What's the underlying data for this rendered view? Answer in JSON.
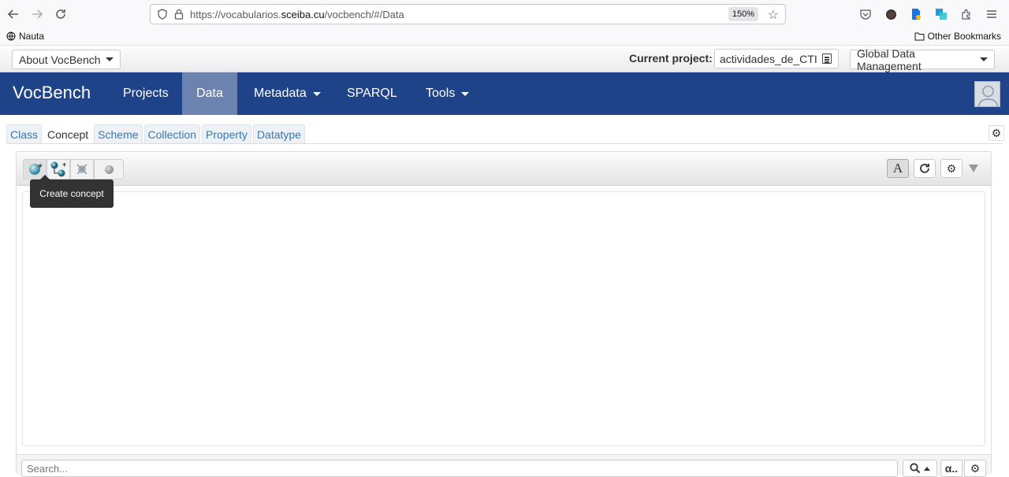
{
  "browser": {
    "url_prefix": "https://vocabularios.",
    "url_domain": "sceiba.cu",
    "url_suffix": "/vocbench/#/Data",
    "zoom": "150%",
    "bookmark_left": "Nauta",
    "bookmark_right": "Other Bookmarks"
  },
  "topbar": {
    "about_label": "About VocBench",
    "current_project_label": "Current project:",
    "current_project_value": "actividades_de_CTI",
    "global_data_label": "Global Data Management"
  },
  "navbar": {
    "brand": "VocBench",
    "items": [
      {
        "label": "Projects"
      },
      {
        "label": "Data"
      },
      {
        "label": "Metadata"
      },
      {
        "label": "SPARQL"
      },
      {
        "label": "Tools"
      }
    ]
  },
  "tabs": [
    "Class",
    "Concept",
    "Scheme",
    "Collection",
    "Property",
    "Datatype"
  ],
  "active_tab": "Concept",
  "panel": {
    "tooltip": "Create concept",
    "lang_button": "A",
    "search_placeholder": "Search...",
    "alpha_label": "α.."
  },
  "icons": {
    "back": "arrow-left-icon",
    "forward": "arrow-right-icon",
    "reload": "reload-icon",
    "settings": "gear-icon"
  },
  "colors": {
    "navbar": "#1e4388",
    "navbar_active": "#6c83b0",
    "link": "#337ab7"
  }
}
